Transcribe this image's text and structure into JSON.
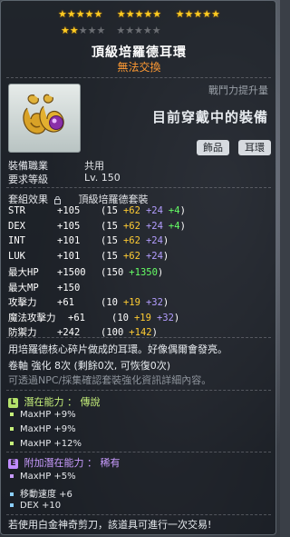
{
  "stars": {
    "filled": 17,
    "total": 25
  },
  "item": {
    "name": "頂級培羅德耳環",
    "trade_status": "無法交換"
  },
  "combat_power": {
    "label": "戰鬥力提升量",
    "equipped_text": "目前穿戴中的裝備"
  },
  "tags": [
    "飾品",
    "耳環"
  ],
  "requirements": [
    {
      "label": "裝備職業",
      "value": "共用"
    },
    {
      "label": "要求等級",
      "value": "Lv. 150"
    }
  ],
  "set_effect": {
    "label": "套組效果",
    "name": "頂級培羅德套裝"
  },
  "stats": [
    {
      "name": "STR",
      "total": "+105",
      "base": "(15",
      "gold": "+62",
      "purple": "+24",
      "green": "+4",
      "close": ")"
    },
    {
      "name": "DEX",
      "total": "+105",
      "base": "(15",
      "gold": "+62",
      "purple": "+24",
      "green": "+4",
      "close": ")"
    },
    {
      "name": "INT",
      "total": "+101",
      "base": "(15",
      "gold": "+62",
      "purple": "+24",
      "green": "",
      "close": ")"
    },
    {
      "name": "LUK",
      "total": "+101",
      "base": "(15",
      "gold": "+62",
      "purple": "+24",
      "green": "",
      "close": ")"
    },
    {
      "name": "最大HP",
      "total": "+1500",
      "base": "(150",
      "gold": "",
      "purple": "",
      "green": "+1350",
      "close": ")"
    },
    {
      "name": "最大MP",
      "total": "+150",
      "base": "",
      "gold": "",
      "purple": "",
      "green": "",
      "close": ""
    },
    {
      "name": "攻擊力",
      "total": "+61",
      "base": "(10",
      "gold": "+19",
      "purple": "+32",
      "green": "",
      "close": ")"
    },
    {
      "name": "魔法攻擊力",
      "total": "+61",
      "base": "(10",
      "gold": "+19",
      "purple": "+32",
      "green": "",
      "close": ")"
    },
    {
      "name": "防禦力",
      "total": "+242",
      "base": "(100",
      "gold": "+142",
      "purple": "",
      "green": "",
      "close": ")"
    }
  ],
  "description": "用培羅德核心碎片做成的耳環。好像偶爾會發亮。",
  "scroll_info": "卷軸 強化 8次 (剩餘0次, 可恢復0次)",
  "note": "可透過NPC/採集確認套裝強化資訊詳細內容。",
  "potential": {
    "label": "潛在能力",
    "separator": "：",
    "grade": "傳說",
    "badge": "L",
    "lines": [
      "MaxHP +9%",
      "MaxHP +9%",
      "MaxHP +12%"
    ]
  },
  "additional_potential": {
    "label": "附加潛在能力",
    "separator": "：",
    "grade": "稀有",
    "badge": "E",
    "lines": [
      "MaxHP +5%",
      "移動速度 +6",
      "DEX +10"
    ]
  },
  "footer": "若使用白金神奇剪刀，該道具可進行一次交易!",
  "colors": {
    "gold": "#ffcc33",
    "purple": "#b39dff",
    "green": "#66ff66",
    "trade_orange": "#ff9a33",
    "legendary": "#c6f07b",
    "epic": "#c99cff"
  }
}
